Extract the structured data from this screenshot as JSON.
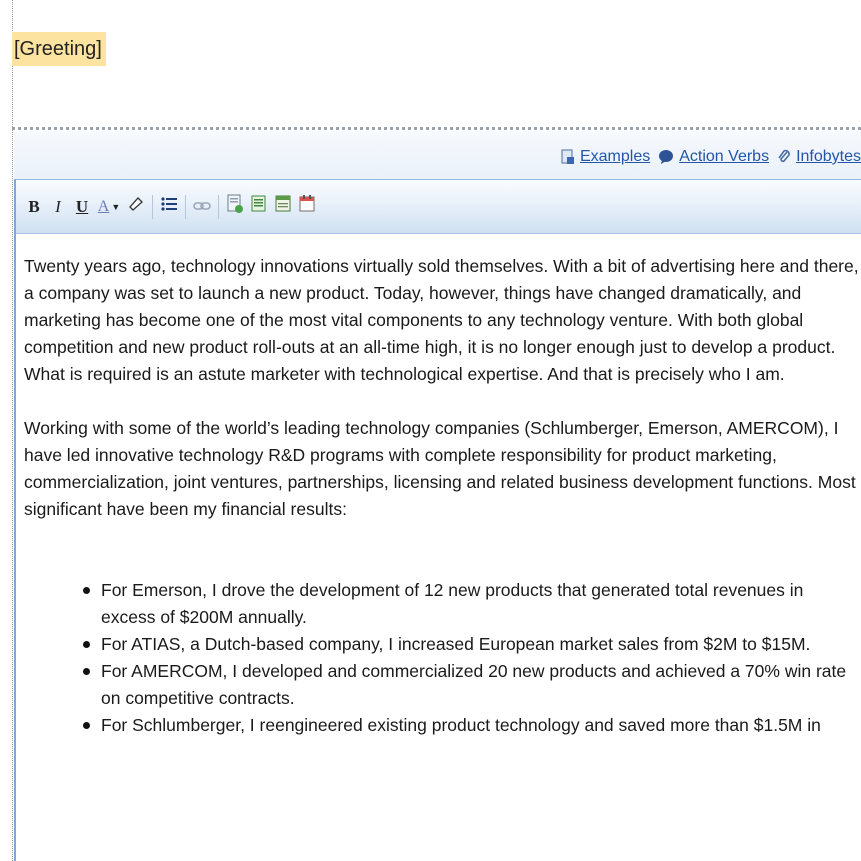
{
  "greeting": {
    "text": "[Greeting]"
  },
  "links": {
    "examples": "Examples",
    "action_verbs": "Action Verbs",
    "infobytes": "Infobytes"
  },
  "toolbar": {
    "bold": "B",
    "italic": "I",
    "underline": "U",
    "font_color": "A"
  },
  "content": {
    "paragraph_1": "Twenty years ago, technology innovations virtually sold themselves. With a bit of advertising here and there, a company was set to launch a new product. Today, however, things have changed dramatically, and marketing has become one of the most vital components to any technology venture. With both global competition and new product roll-outs at an all-time high, it is no longer enough just to develop a product. What is required is an astute marketer with technological expertise. And that is precisely who I am.",
    "paragraph_2": "Working with some of the world’s leading technology companies (Schlumberger, Emerson, AMERCOM), I have led innovative technology R&D programs with complete responsibility for product marketing, commercialization, joint ventures, partnerships, licensing and related business development functions. Most significant have been my financial results:",
    "bullets": [
      "For Emerson, I drove the development of 12 new products that generated total revenues in excess of $200M annually.",
      "For ATIAS, a Dutch-based company, I increased European market sales from $2M to $15M.",
      "For AMERCOM, I developed and commercialized 20 new products and achieved a 70% win rate on competitive contracts.",
      "For Schlumberger, I reengineered existing product technology and saved more than $1.5M in"
    ]
  },
  "colors": {
    "greeting_highlight": "#fde3a0",
    "link": "#2356a8",
    "editor_border": "#7ea9d6"
  }
}
